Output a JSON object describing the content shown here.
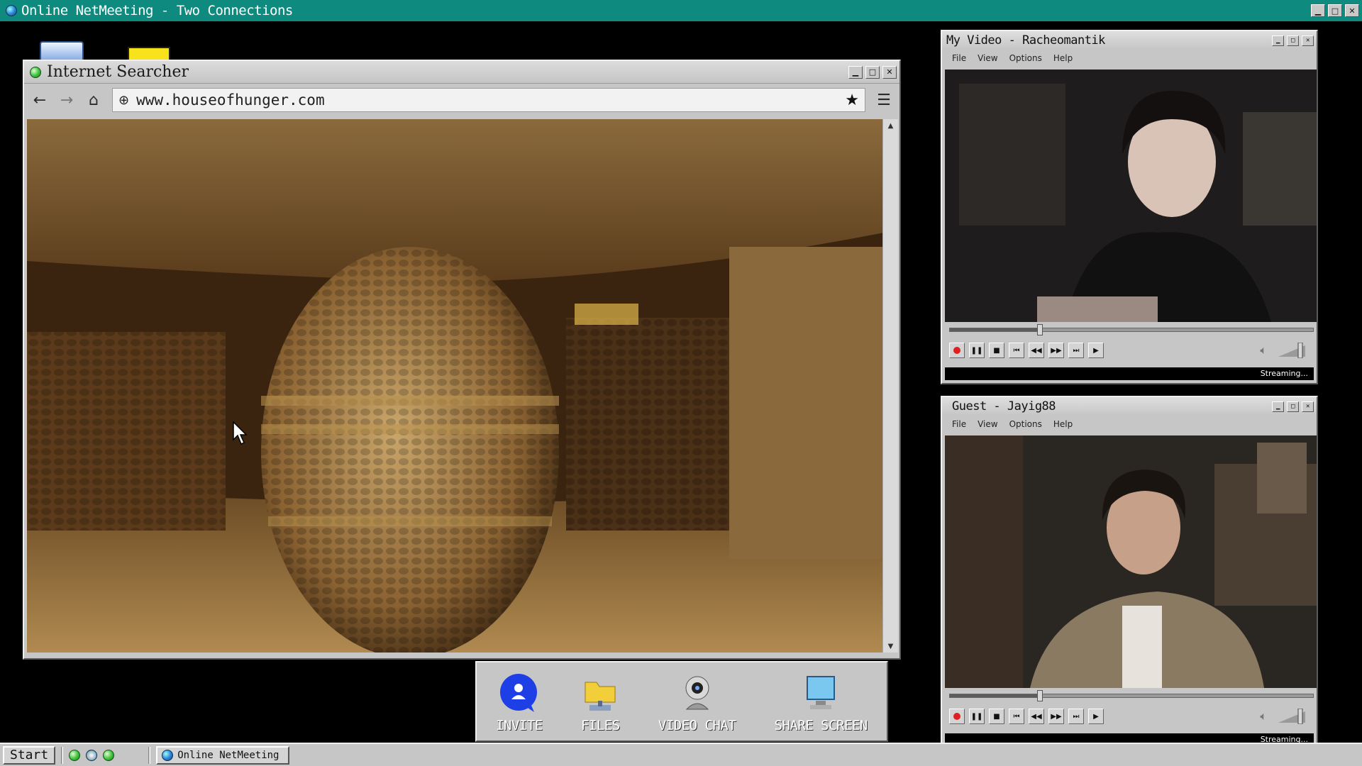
{
  "app": {
    "title": "Online NetMeeting - Two Connections"
  },
  "browser": {
    "title": "Internet Searcher",
    "url": "www.houseofhunger.com",
    "nav": {
      "back": "←",
      "forward": "→",
      "home": "⌂",
      "bookmark": "★",
      "menu": "☰"
    }
  },
  "toolbar": {
    "items": [
      {
        "label": "INVITE",
        "icon": "user-bubble-icon"
      },
      {
        "label": "FILES",
        "icon": "folder-icon"
      },
      {
        "label": "VIDEO CHAT",
        "icon": "webcam-icon"
      },
      {
        "label": "SHARE SCREEN",
        "icon": "monitor-icon"
      }
    ]
  },
  "my_video": {
    "title": "My Video - Racheomantik",
    "menu": [
      "File",
      "View",
      "Options",
      "Help"
    ],
    "status": "Streaming...",
    "progress": 0.24
  },
  "guest_video": {
    "title": "Guest - Jayig88",
    "menu": [
      "File",
      "View",
      "Options",
      "Help"
    ],
    "status": "Streaming...",
    "progress": 0.24
  },
  "taskbar": {
    "start": "Start",
    "task": "Online NetMeeting"
  },
  "colors": {
    "titlebar": "#0f8a7e",
    "chrome": "#c6c6c6",
    "record": "#e02020"
  }
}
